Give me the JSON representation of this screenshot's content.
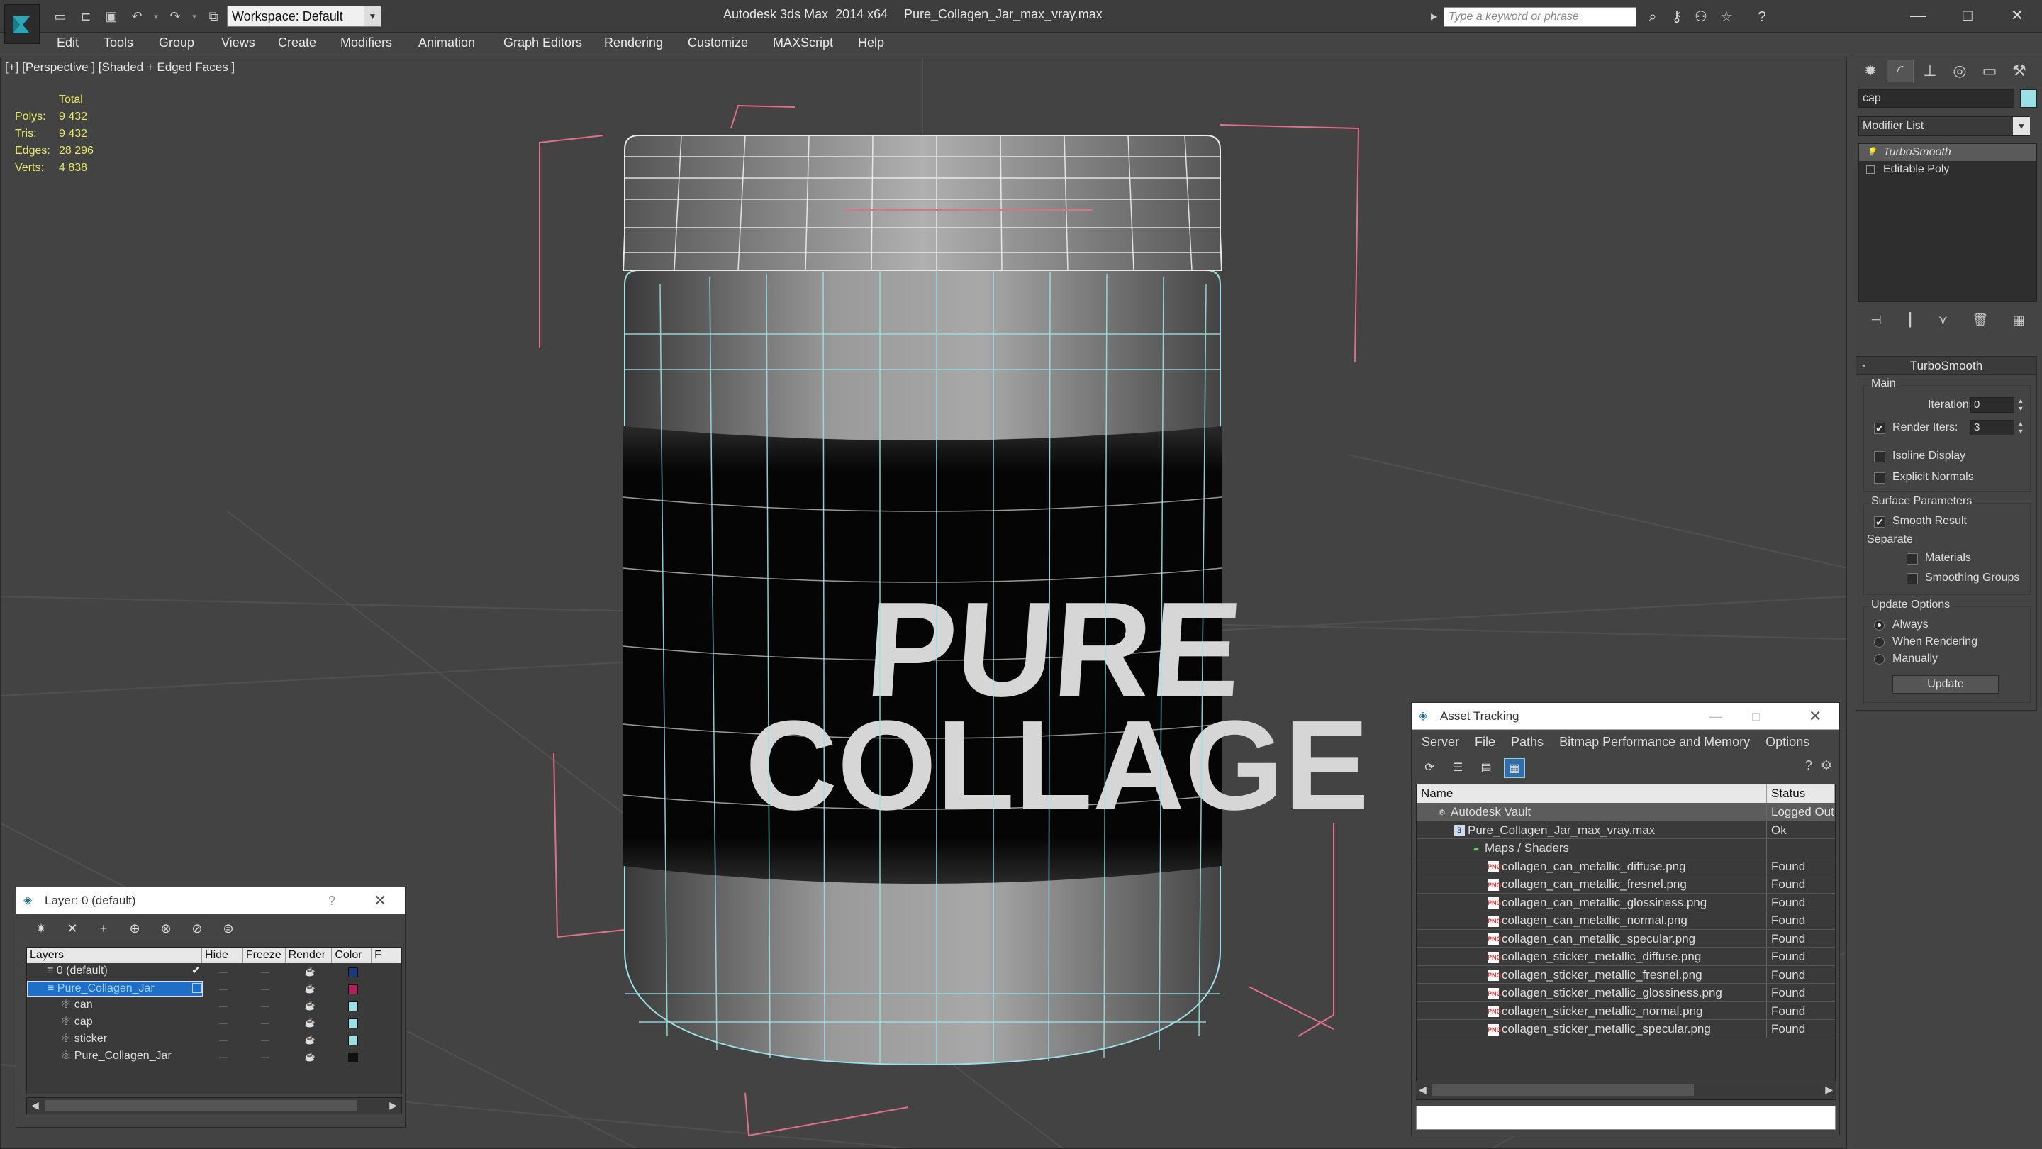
{
  "app": {
    "title": "Autodesk 3ds Max  2014 x64",
    "file": "Pure_Collagen_Jar_max_vray.max",
    "workspace": "Workspace: Default",
    "search_placeholder": "Type a keyword or phrase"
  },
  "menus": [
    "Edit",
    "Tools",
    "Group",
    "Views",
    "Create",
    "Modifiers",
    "Animation",
    "Graph Editors",
    "Rendering",
    "Customize",
    "MAXScript",
    "Help"
  ],
  "viewport": {
    "label": "[+] [Perspective ] [Shaded + Edged Faces ]",
    "stats": {
      "header": "Total",
      "rows": [
        {
          "key": "Polys:",
          "value": "9 432"
        },
        {
          "key": "Tris:",
          "value": "9 432"
        },
        {
          "key": "Edges:",
          "value": "28 296"
        },
        {
          "key": "Verts:",
          "value": "4 838"
        }
      ]
    },
    "label_line1": "PURE",
    "label_line2": "COLLAGE"
  },
  "command_panel": {
    "object_name": "cap",
    "object_color": "#9ce0e6",
    "modifier_list": "Modifier List",
    "stack": [
      "TurboSmooth",
      "Editable Poly"
    ],
    "rollout": {
      "title": "TurboSmooth",
      "main_group": "Main",
      "iterations_label": "Iterations:",
      "iterations_value": "0",
      "render_iters_label": "Render Iters:",
      "render_iters_value": "3",
      "isoline_display": "Isoline Display",
      "explicit_normals": "Explicit Normals",
      "surface_group": "Surface Parameters",
      "smooth_result": "Smooth Result",
      "separate": "Separate",
      "materials": "Materials",
      "smoothing_groups": "Smoothing Groups",
      "update_group": "Update Options",
      "always": "Always",
      "when_rendering": "When Rendering",
      "manually": "Manually",
      "update_button": "Update"
    }
  },
  "layer_window": {
    "title": "Layer: 0 (default)",
    "help": "?",
    "columns": [
      "Layers",
      "Hide",
      "Freeze",
      "Render",
      "Color",
      "F"
    ],
    "rows": [
      {
        "name": "0 (default)",
        "color": "#1a3a7a",
        "indent": 1,
        "checked": true
      },
      {
        "name": "Pure_Collagen_Jar",
        "color": "#b0205a",
        "indent": 1,
        "selected": true
      },
      {
        "name": "can",
        "color": "#9ce0e6",
        "indent": 2
      },
      {
        "name": "cap",
        "color": "#9ce0e6",
        "indent": 2
      },
      {
        "name": "sticker",
        "color": "#9ce0e6",
        "indent": 2
      },
      {
        "name": "Pure_Collagen_Jar",
        "color": "#111111",
        "indent": 2
      }
    ]
  },
  "asset_window": {
    "title": "Asset Tracking",
    "menus": [
      "Server",
      "File",
      "Paths",
      "Bitmap Performance and Memory",
      "Options"
    ],
    "columns": [
      "Name",
      "Status"
    ],
    "rows": [
      {
        "name": "Autodesk Vault",
        "status": "Logged Out",
        "level": 0,
        "icon": "vault"
      },
      {
        "name": "Pure_Collagen_Jar_max_vray.max",
        "status": "Ok",
        "level": 1,
        "icon": "max"
      },
      {
        "name": "Maps / Shaders",
        "status": "",
        "level": 2,
        "icon": "maps"
      },
      {
        "name": "collagen_can_metallic_diffuse.png",
        "status": "Found",
        "level": 3,
        "icon": "png"
      },
      {
        "name": "collagen_can_metallic_fresnel.png",
        "status": "Found",
        "level": 3,
        "icon": "png"
      },
      {
        "name": "collagen_can_metallic_glossiness.png",
        "status": "Found",
        "level": 3,
        "icon": "png"
      },
      {
        "name": "collagen_can_metallic_normal.png",
        "status": "Found",
        "level": 3,
        "icon": "png"
      },
      {
        "name": "collagen_can_metallic_specular.png",
        "status": "Found",
        "level": 3,
        "icon": "png"
      },
      {
        "name": "collagen_sticker_metallic_diffuse.png",
        "status": "Found",
        "level": 3,
        "icon": "png"
      },
      {
        "name": "collagen_sticker_metallic_fresnel.png",
        "status": "Found",
        "level": 3,
        "icon": "png"
      },
      {
        "name": "collagen_sticker_metallic_glossiness.png",
        "status": "Found",
        "level": 3,
        "icon": "png"
      },
      {
        "name": "collagen_sticker_metallic_normal.png",
        "status": "Found",
        "level": 3,
        "icon": "png"
      },
      {
        "name": "collagen_sticker_metallic_specular.png",
        "status": "Found",
        "level": 3,
        "icon": "png"
      }
    ]
  }
}
